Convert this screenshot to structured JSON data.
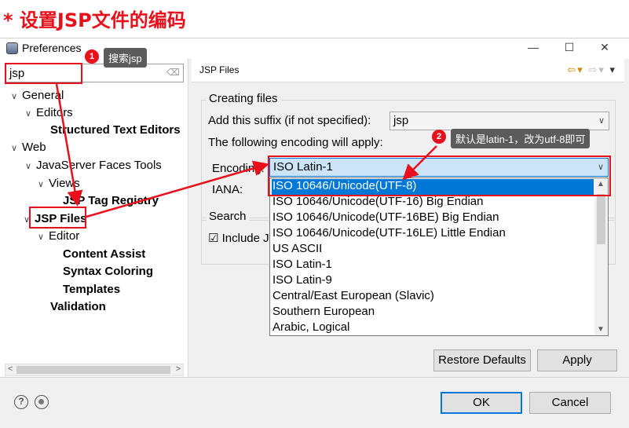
{
  "banner": {
    "title": "* 设置JSP文件的编码"
  },
  "window": {
    "title": "Preferences",
    "minimize": "—",
    "maximize": "☐",
    "close": "✕"
  },
  "filter": {
    "value": "jsp",
    "clear_icon": "eraser-icon"
  },
  "tree": {
    "general": "General",
    "editors": "Editors",
    "structured_text_editors": "Structured Text Editors",
    "web": "Web",
    "jsf_tools": "JavaServer Faces Tools",
    "views": "Views",
    "jsp_tag_registry": "JSP Tag Registry",
    "jsp_files": "JSP Files",
    "editor": "Editor",
    "content_assist": "Content Assist",
    "syntax_coloring": "Syntax Coloring",
    "templates": "Templates",
    "validation": "Validation"
  },
  "page": {
    "title": "JSP Files",
    "creating_files_group": "Creating files",
    "suffix_label": "Add this suffix (if not specified):",
    "suffix_value": "jsp",
    "encoding_note": "The following encoding will apply:",
    "encoding_label": "Encoding:",
    "encoding_value": "ISO Latin-1",
    "iana_label": "IANA:",
    "search_group": "Search",
    "include_label": "Include J"
  },
  "dropdown": {
    "items": [
      "ISO 10646/Unicode(UTF-8)",
      "ISO 10646/Unicode(UTF-16) Big Endian",
      "ISO 10646/Unicode(UTF-16BE) Big Endian",
      "ISO 10646/Unicode(UTF-16LE) Little Endian",
      "US ASCII",
      "ISO Latin-1",
      "ISO Latin-9",
      "Central/East European (Slavic)",
      "Southern European",
      "Arabic, Logical"
    ]
  },
  "buttons": {
    "restore_defaults": "Restore Defaults",
    "apply": "Apply",
    "ok": "OK",
    "cancel": "Cancel"
  },
  "annotations": {
    "step1_num": "1",
    "step1_text": "搜索jsp",
    "step2_num": "2",
    "step2_text": "默认是latin-1，改为utf-8即可"
  },
  "colors": {
    "annotation_red": "#e8101b",
    "selection_blue": "#0078d7"
  }
}
